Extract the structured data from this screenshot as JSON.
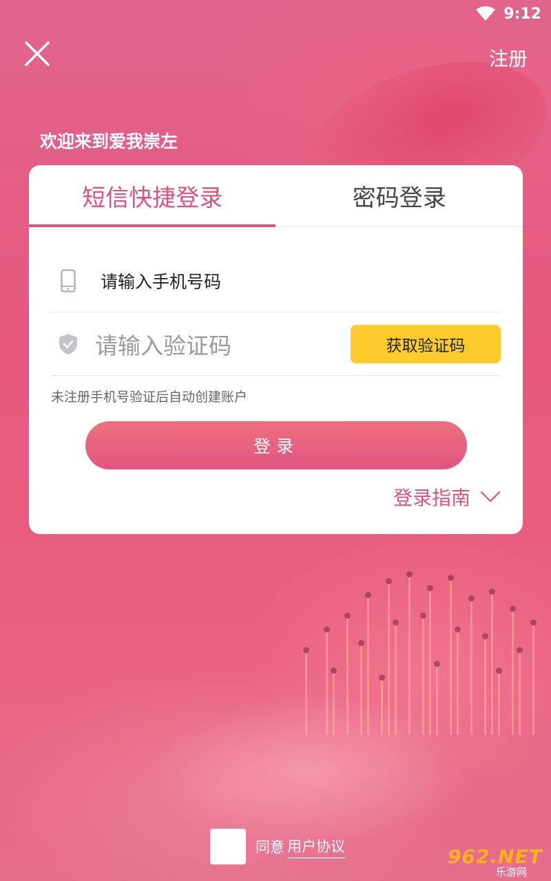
{
  "status_bar": {
    "time": "9:12"
  },
  "header": {
    "register_label": "注册"
  },
  "welcome_text": "欢迎来到爱我崇左",
  "tabs": [
    {
      "label": "短信快捷登录",
      "active": true
    },
    {
      "label": "密码登录",
      "active": false
    }
  ],
  "form": {
    "phone_placeholder": "请输入手机号码",
    "code_placeholder": "请输入验证码",
    "get_code_label": "获取验证码",
    "hint": "未注册手机号验证后自动创建账户",
    "login_label": "登录",
    "guide_label": "登录指南"
  },
  "agreement": {
    "prefix": "同意",
    "link": "用户协议",
    "checked": false
  },
  "watermark": {
    "main": "962.NET",
    "sub": "乐游网"
  },
  "colors": {
    "accent": "#e0517b",
    "button_yellow": "#fccb2c",
    "login_gradient_top": "#ee6f7e",
    "login_gradient_bottom": "#e25583"
  }
}
